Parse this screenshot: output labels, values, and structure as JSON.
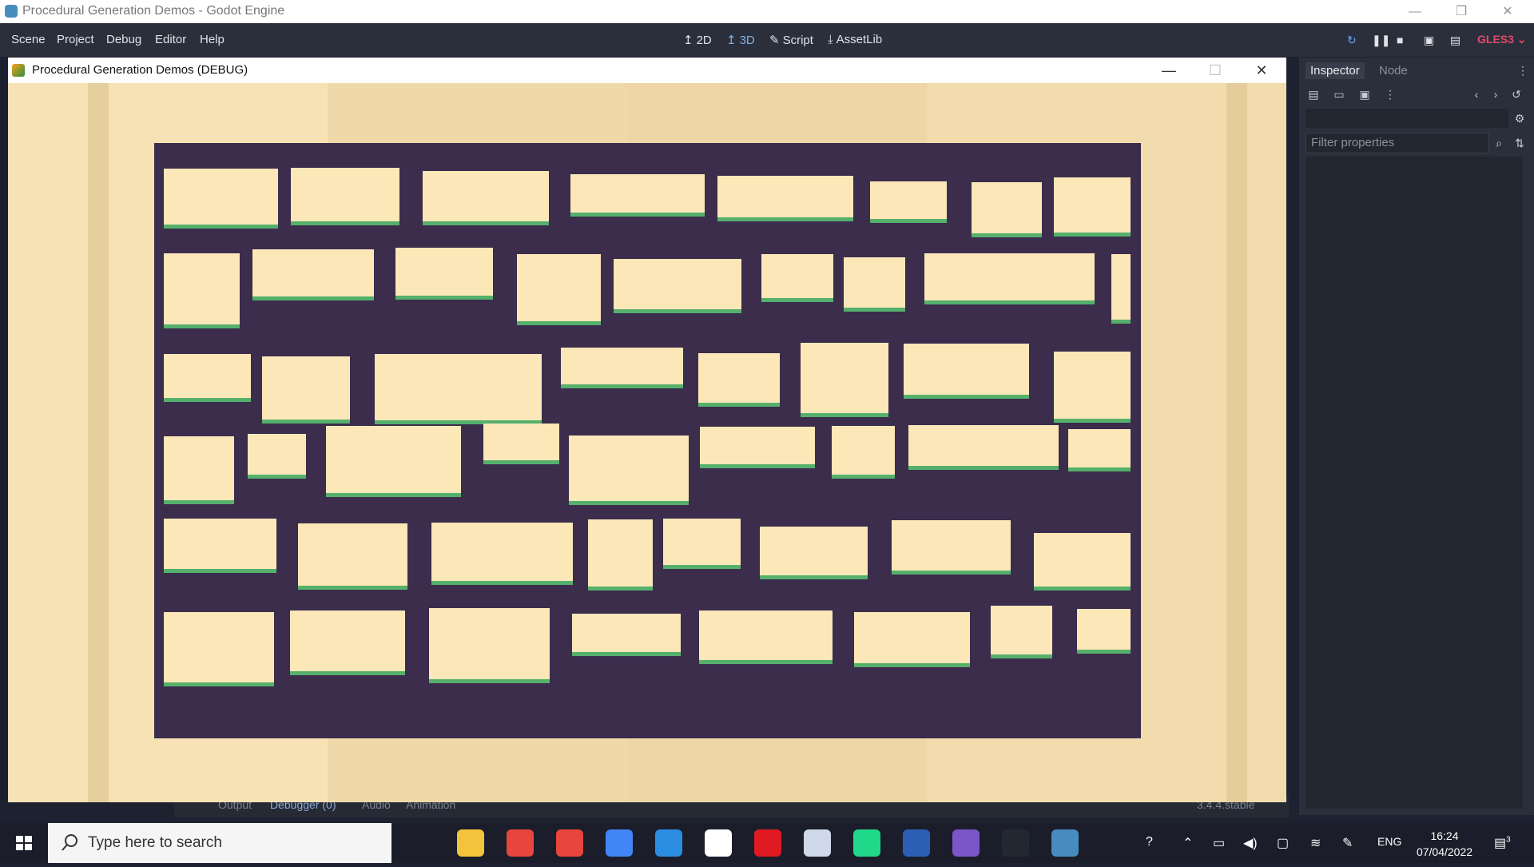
{
  "window": {
    "title": "Procedural Generation Demos - Godot Engine"
  },
  "menu": [
    "Scene",
    "Project",
    "Debug",
    "Editor",
    "Help"
  ],
  "workspaces": [
    "2D",
    "3D",
    "Script",
    "AssetLib"
  ],
  "renderer": "GLES3",
  "game_window": {
    "title": "Procedural Generation Demos (DEBUG)"
  },
  "bottom_tabs": [
    "Output",
    "Debugger (0)",
    "Audio",
    "Animation"
  ],
  "version": "3.4.4.stable",
  "inspector": {
    "tabs": [
      "Inspector",
      "Node"
    ],
    "filter_placeholder": "Filter properties"
  },
  "taskbar": {
    "search_placeholder": "Type here to search",
    "apps": [
      "explorer-icon",
      "chrome-icon",
      "chrome-profile-icon",
      "chrome-profile-2-icon",
      "vscode-icon",
      "notepad-icon",
      "opera-icon",
      "paint-icon",
      "pycharm-icon",
      "word-icon",
      "app-icon",
      "terminal-icon",
      "godot-icon"
    ],
    "language": "ENG",
    "time": "16:24",
    "date": "07/04/2022",
    "notifications": "3"
  },
  "colors": {
    "editor_bg": "#2b2f3b",
    "accent": "#478cbf",
    "map_wall": "#3c2d4c",
    "map_open": "#fbe7b8",
    "grass": "#55b06c",
    "renderer_badge": "#e04a6a"
  }
}
